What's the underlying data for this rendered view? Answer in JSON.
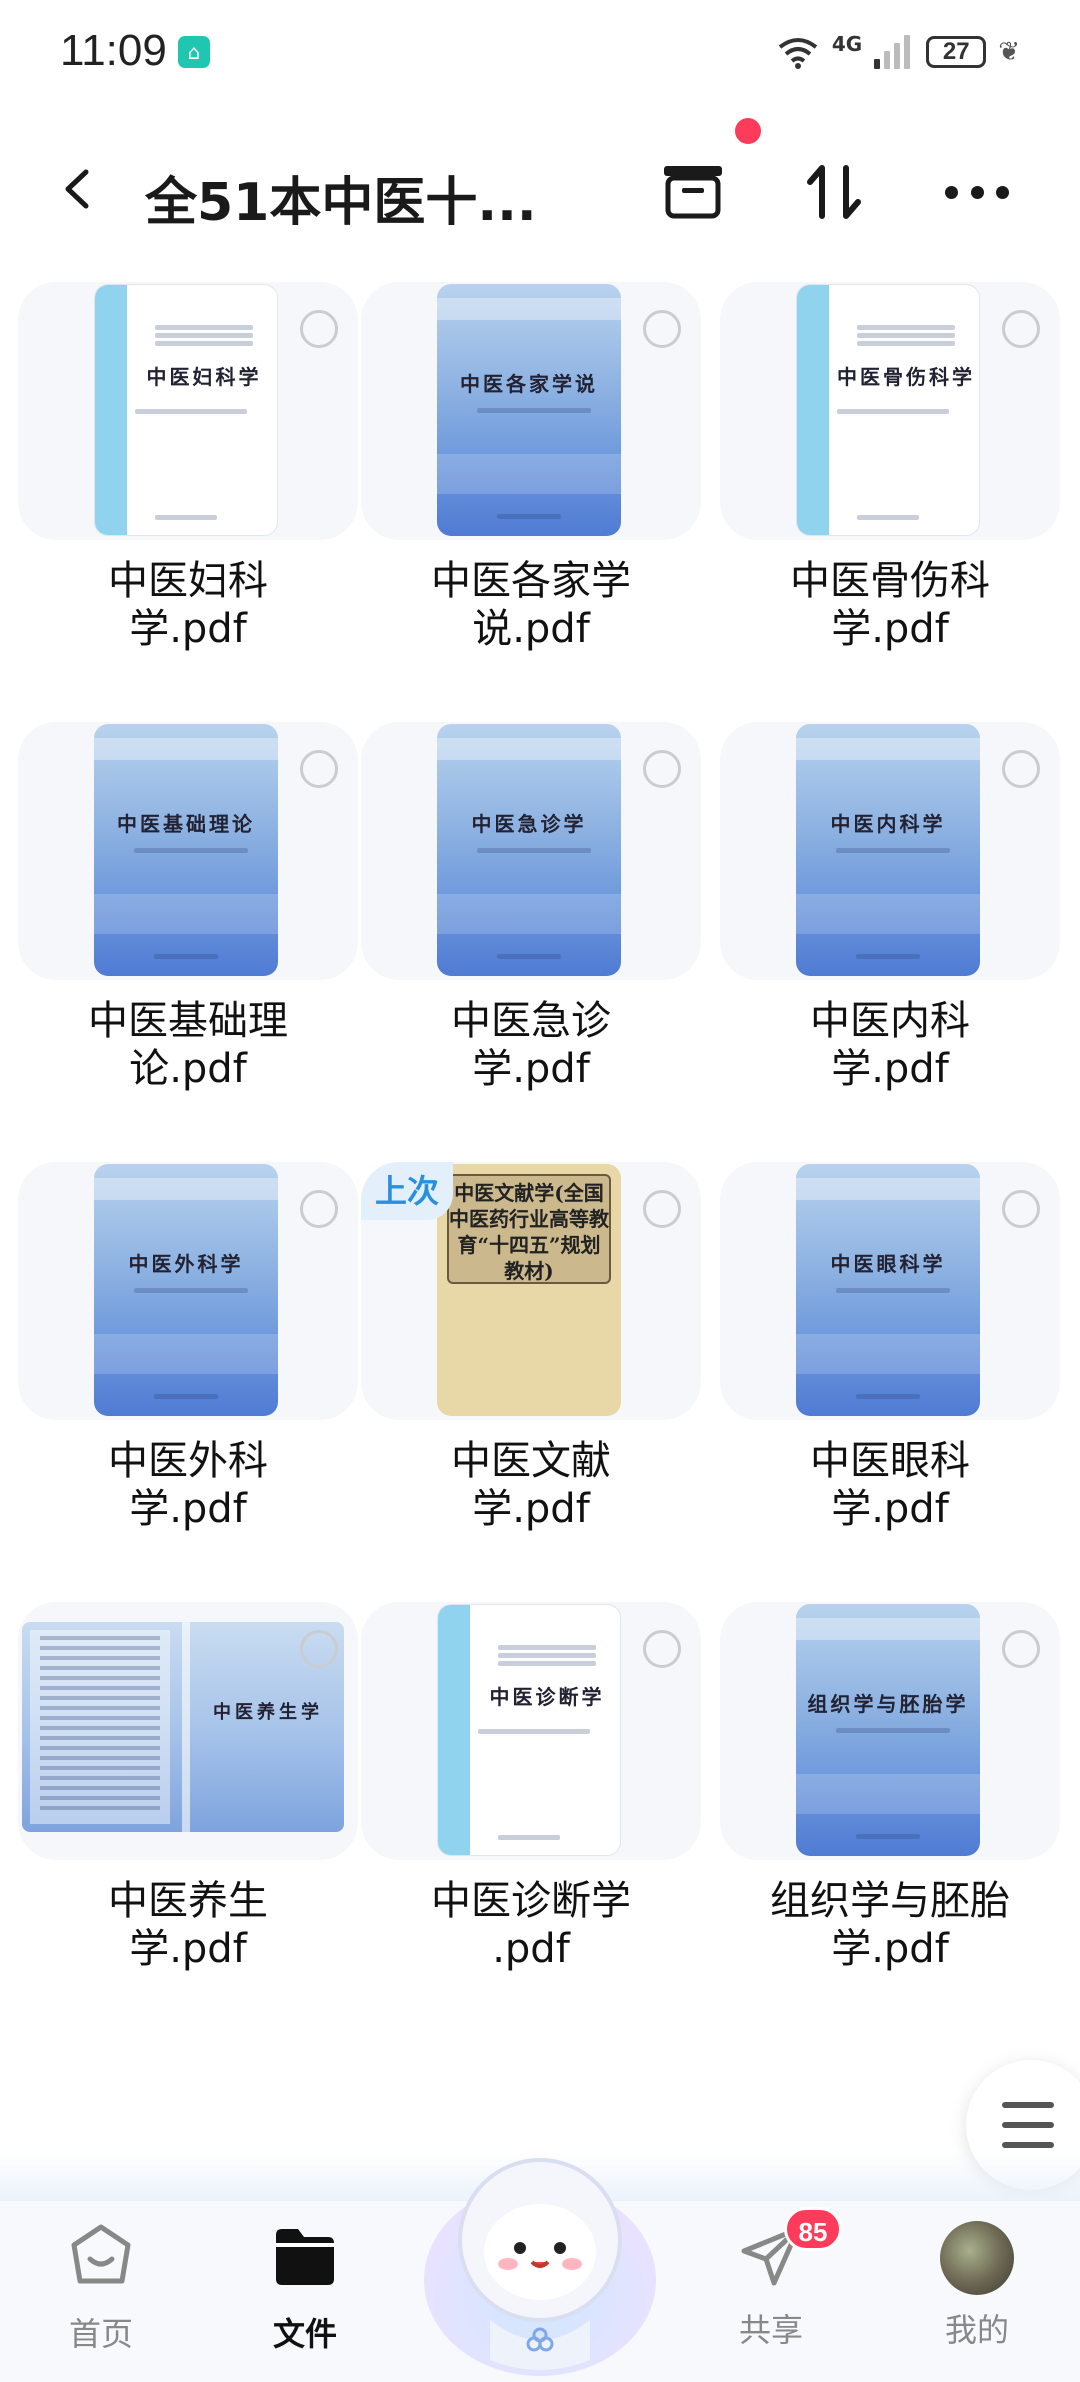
{
  "status_bar": {
    "time": "11:09",
    "network": "4G",
    "battery": "27"
  },
  "header": {
    "title": "全51本中医十..."
  },
  "files": [
    {
      "name": "中医妇科学.pdf",
      "cover_title": "中医妇科学",
      "cover_style": "white",
      "last_opened": false
    },
    {
      "name": "中医各家学说.pdf",
      "cover_title": "中医各家学说",
      "cover_style": "blue",
      "last_opened": false
    },
    {
      "name": "中医骨伤科学.pdf",
      "cover_title": "中医骨伤科学",
      "cover_style": "white",
      "last_opened": false
    },
    {
      "name": "中医基础理论.pdf",
      "cover_title": "中医基础理论",
      "cover_style": "blue",
      "last_opened": false
    },
    {
      "name": "中医急诊学.pdf",
      "cover_title": "中医急诊学",
      "cover_style": "blue",
      "last_opened": false
    },
    {
      "name": "中医内科学.pdf",
      "cover_title": "中医内科学",
      "cover_style": "blue",
      "last_opened": false
    },
    {
      "name": "中医外科学.pdf",
      "cover_title": "中医外科学",
      "cover_style": "blue",
      "last_opened": false
    },
    {
      "name": "中医文献学.pdf",
      "cover_title": "中医文献学(全国中医药行业高等教育“十四五”规划教材)",
      "cover_style": "tan",
      "last_opened": true
    },
    {
      "name": "中医眼科学.pdf",
      "cover_title": "中医眼科学",
      "cover_style": "blue",
      "last_opened": false
    },
    {
      "name": "中医养生学.pdf",
      "cover_title": "中医养生学",
      "cover_style": "wide",
      "last_opened": false
    },
    {
      "name": "中医诊断学 .pdf",
      "cover_title": "中医诊断学",
      "cover_style": "white",
      "last_opened": false
    },
    {
      "name": "组织学与胚胎学.pdf",
      "cover_title": "组织学与胚胎学",
      "cover_style": "blue",
      "last_opened": false
    }
  ],
  "last_opened_tag": "上次",
  "bottom_nav": {
    "home": "首页",
    "files": "文件",
    "share": "共享",
    "share_badge": "85",
    "mine": "我的"
  },
  "colors": {
    "accent_red": "#ff3b5c",
    "tag_blue": "#2b8fe0",
    "card_bg": "#f5f7fa"
  }
}
